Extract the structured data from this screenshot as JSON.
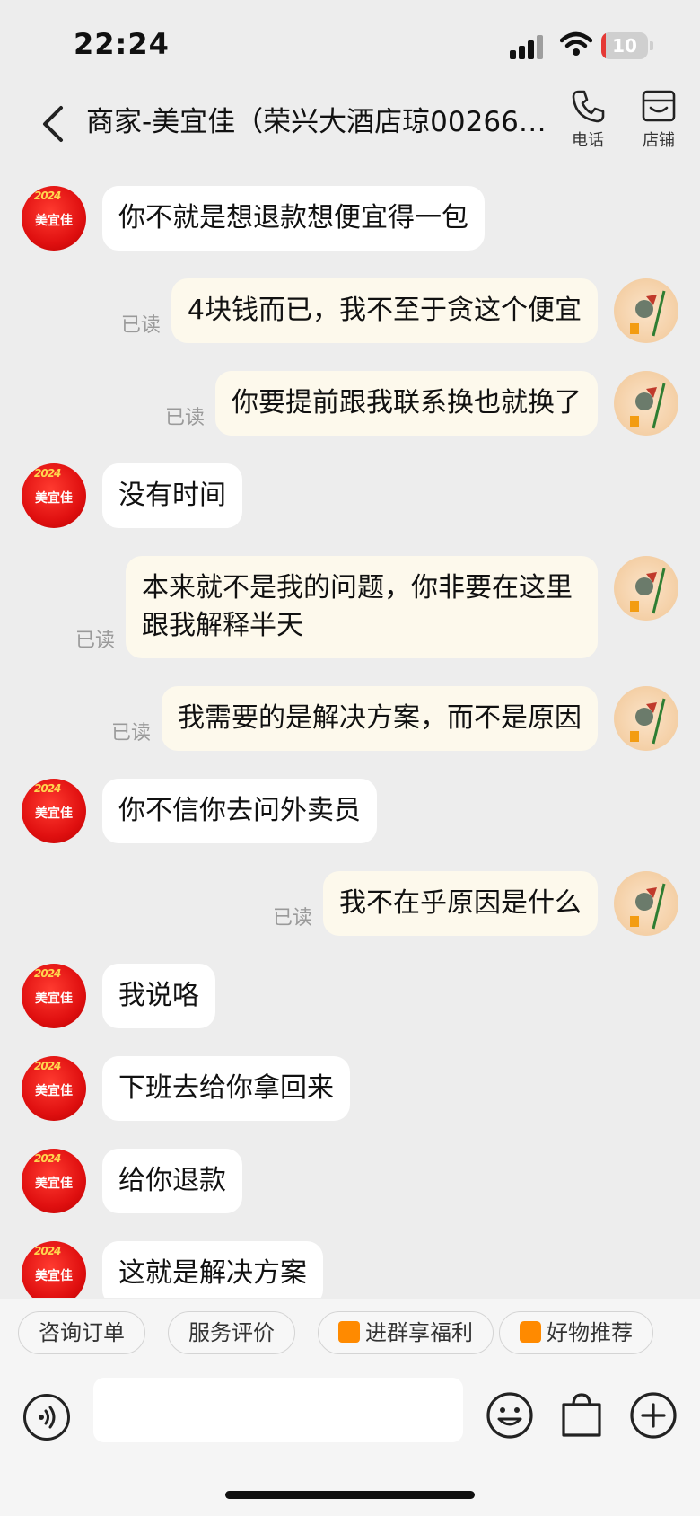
{
  "status_bar": {
    "time": "22:24",
    "battery": "10"
  },
  "header": {
    "title": "商家-美宜佳（荣兴大酒店琼00266…",
    "phone_label": "电话",
    "store_label": "店铺"
  },
  "merchant_avatar": {
    "name": "美宜佳",
    "deco": "2024"
  },
  "messages": [
    {
      "side": "left",
      "text": "你不就是想退款想便宜得一包"
    },
    {
      "side": "right",
      "text": "4块钱而已，我不至于贪这个便宜",
      "status": "已读"
    },
    {
      "side": "right",
      "text": "你要提前跟我联系换也就换了",
      "status": "已读"
    },
    {
      "side": "left",
      "text": "没有时间"
    },
    {
      "side": "right",
      "text": "本来就不是我的问题，你非要在这里跟我解释半天",
      "status": "已读"
    },
    {
      "side": "right",
      "text": "我需要的是解决方案，而不是原因",
      "status": "已读"
    },
    {
      "side": "left",
      "text": "你不信你去问外卖员"
    },
    {
      "side": "right",
      "text": "我不在乎原因是什么",
      "status": "已读"
    },
    {
      "side": "left",
      "text": "我说咯"
    },
    {
      "side": "left",
      "text": "下班去给你拿回来"
    },
    {
      "side": "left",
      "text": "给你退款"
    },
    {
      "side": "left",
      "text": "这就是解决方案"
    }
  ],
  "quick_replies": [
    {
      "label": "咨询订单"
    },
    {
      "label": "服务评价"
    },
    {
      "label": "进群享福利",
      "icon": "group-icon"
    },
    {
      "label": "好物推荐",
      "icon": "shopping-bag-icon"
    }
  ],
  "input": {
    "placeholder": ""
  },
  "colors": {
    "accent_orange": "#ff8a00",
    "merchant_red": "#e01010",
    "my_bubble": "#fdf9ec"
  }
}
